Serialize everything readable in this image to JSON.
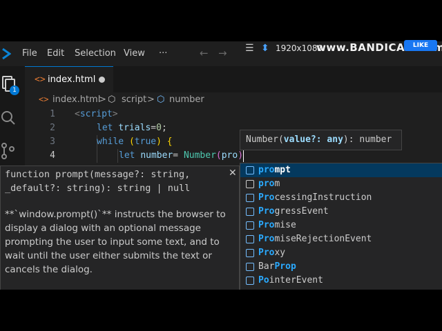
{
  "menubar": {
    "items": [
      "File",
      "Edit",
      "Selection",
      "View",
      "···"
    ]
  },
  "recorder": {
    "resolution": "1920x1080",
    "watermark": "www.BANDICAM.com",
    "like": "LIKE"
  },
  "activity": {
    "badge": "1"
  },
  "tab": {
    "icon": "<>",
    "label": "index.html"
  },
  "breadcrumb": {
    "file": "index.html",
    "sep": ">",
    "script": "script",
    "symbol": "number"
  },
  "editor": {
    "line_numbers": [
      "1",
      "2",
      "3",
      "4"
    ],
    "line1_tag_open": "<",
    "line1_tagname": "script",
    "line1_tag_close": ">",
    "line2_kw": "let",
    "line2_var": "trials",
    "line2_eq": "=",
    "line2_num": "0",
    "line2_semi": ";",
    "line3_kw": "while",
    "line3_paren_open": "(",
    "line3_true": "true",
    "line3_paren_close": ")",
    "line3_brace": "{",
    "line4_kw": "let",
    "line4_var": "number",
    "line4_eq": "= ",
    "line4_fn": "Number",
    "line4_paren": "(",
    "line4_arg": "pro",
    "line4_paren_close": ")"
  },
  "signature": {
    "prefix": "Number(",
    "param": "value?: any",
    "suffix": "): number"
  },
  "docs": {
    "signature": "function prompt(message?: string, _default?: string): string | null",
    "close": "✕",
    "description": "**`window.prompt()`** instructs the browser to display a dialog with an optional message prompting the user to input some text, and to wait until the user either submits the text or cancels the dialog."
  },
  "suggestions": [
    {
      "match": "pro",
      "rest": "mpt",
      "icon": "method-icon",
      "selected": true
    },
    {
      "match": "pro",
      "rest": "m",
      "icon": "text-icon",
      "selected": false
    },
    {
      "match": "Pro",
      "rest": "cessingInstruction",
      "icon": "class-icon",
      "selected": false
    },
    {
      "match": "Pro",
      "rest": "gressEvent",
      "icon": "class-icon",
      "selected": false
    },
    {
      "match": "Pro",
      "rest": "mise",
      "icon": "class-icon",
      "selected": false
    },
    {
      "match": "Pro",
      "rest": "miseRejectionEvent",
      "icon": "class-icon",
      "selected": false
    },
    {
      "match": "Pro",
      "rest": "xy",
      "icon": "class-icon",
      "selected": false
    },
    {
      "pre": "Bar",
      "match": "Prop",
      "rest": "",
      "icon": "class-icon",
      "selected": false
    },
    {
      "match": "Po",
      "rest": "interEvent",
      "icon": "class-icon",
      "selected": false
    }
  ],
  "colors": {
    "accent": "#0078d4",
    "editor_bg": "#1f1f1f",
    "match": "#2aaaff"
  }
}
